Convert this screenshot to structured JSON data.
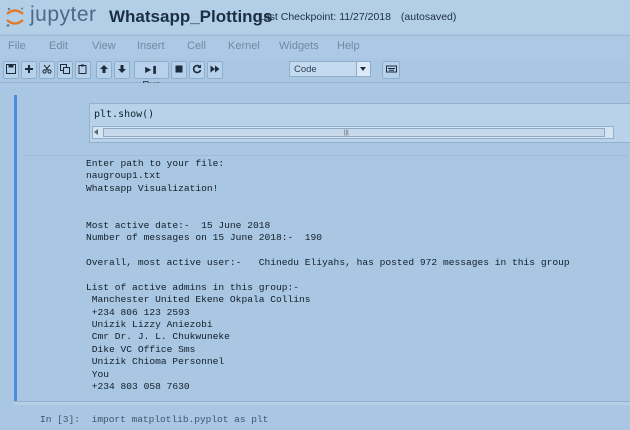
{
  "header": {
    "brand": "jupyter",
    "notebook_title": "Whatsapp_Plottings",
    "checkpoint_label": "Last Checkpoint:",
    "checkpoint_time": "11/27/2018",
    "autosave_status": "(autosaved)"
  },
  "menu": [
    "File",
    "Edit",
    "View",
    "Insert",
    "Cell",
    "Kernel",
    "Widgets",
    "Help"
  ],
  "toolbar": {
    "run_label": "Run",
    "cell_type": "Code"
  },
  "cell": {
    "code": "plt.show()",
    "output_lines": [
      "Enter path to your file:",
      "naugroup1.txt",
      "Whatsapp Visualization!",
      "",
      "",
      "Most active date:-  15 June 2018",
      "Number of messages on 15 June 2018:-  190",
      "",
      "Overall, most active user:-   Chinedu Eliyahs, has posted 972 messages in this group",
      "",
      "List of active admins in this group:-",
      " Manchester United Ekene Okpala Collins",
      " +234 806 123 2593",
      " Unizik Lizzy Aniezobi",
      " Cmr Dr. J. L. Chukwuneke",
      " Dike VC Office Sms",
      " Unizik Chioma Personnel",
      " You",
      " +234 803 058 7630"
    ]
  },
  "next_cell": {
    "prompt": "In [3]:",
    "code": "import matplotlib.pyplot as plt"
  }
}
